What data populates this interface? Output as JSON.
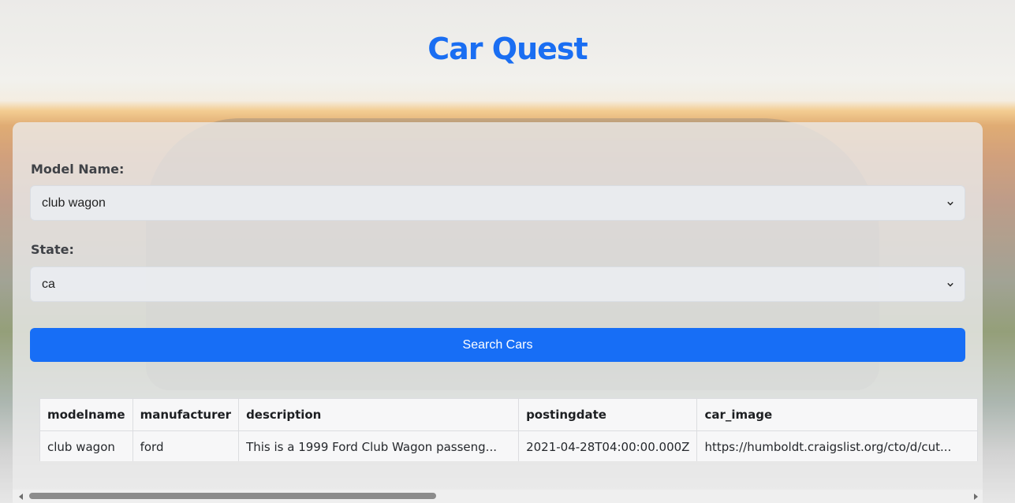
{
  "app": {
    "title": "Car Quest"
  },
  "form": {
    "model_label": "Model Name:",
    "model_value": "club wagon",
    "state_label": "State:",
    "state_value": "ca",
    "search_label": "Search Cars"
  },
  "results": {
    "columns": [
      "modelname",
      "manufacturer",
      "description",
      "postingdate",
      "car_image"
    ],
    "rows": [
      [
        "club wagon",
        "ford",
        "This is a 1999 Ford Club Wagon passeng...",
        "2021-04-28T04:00:00.000Z",
        "https://humboldt.craigslist.org/cto/d/cut..."
      ]
    ]
  },
  "colors": {
    "accent": "#176ef6",
    "title": "#1a6ef2"
  }
}
